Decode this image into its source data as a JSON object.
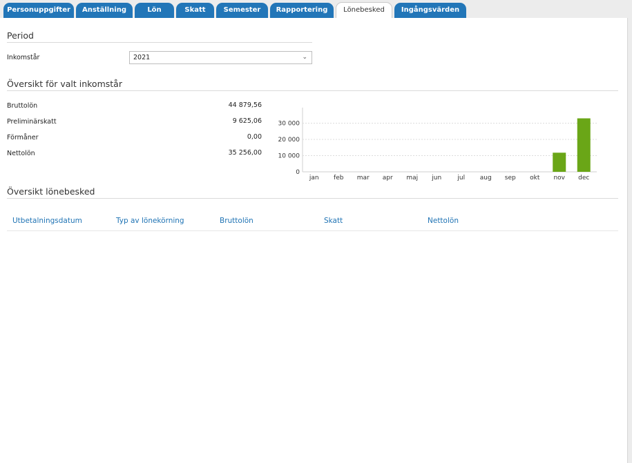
{
  "tabs": [
    {
      "label": "Personuppgifter",
      "active": false
    },
    {
      "label": "Anställning",
      "active": false
    },
    {
      "label": "Lön",
      "active": false
    },
    {
      "label": "Skatt",
      "active": false
    },
    {
      "label": "Semester",
      "active": false
    },
    {
      "label": "Rapportering",
      "active": false
    },
    {
      "label": "Lönebesked",
      "active": true
    },
    {
      "label": "Ingångsvärden",
      "active": false
    }
  ],
  "period": {
    "title": "Period",
    "income_year_label": "Inkomstår",
    "income_year_value": "2021"
  },
  "overview": {
    "title": "Översikt för valt inkomstår",
    "rows": [
      {
        "label": "Bruttolön",
        "value": "44 879,56"
      },
      {
        "label": "Preliminärskatt",
        "value": "9 625,06"
      },
      {
        "label": "Förmåner",
        "value": "0,00"
      },
      {
        "label": "Nettolön",
        "value": "35 256,00"
      }
    ]
  },
  "chart_data": {
    "type": "bar",
    "categories": [
      "jan",
      "feb",
      "mar",
      "apr",
      "maj",
      "jun",
      "jul",
      "aug",
      "sep",
      "okt",
      "nov",
      "dec"
    ],
    "values": [
      0,
      0,
      0,
      0,
      0,
      0,
      0,
      0,
      0,
      0,
      11800,
      33000
    ],
    "yticks": [
      "0",
      "10 000",
      "20 000",
      "30 000"
    ],
    "ytick_values": [
      0,
      10000,
      20000,
      30000
    ],
    "ylim": [
      0,
      40000
    ],
    "grid": true,
    "bar_color": "#6aa617"
  },
  "payslips": {
    "title": "Översikt lönebesked",
    "columns": [
      "Utbetalningsdatum",
      "Typ av lönekörning",
      "Bruttolön",
      "Skatt",
      "Nettolön"
    ]
  }
}
